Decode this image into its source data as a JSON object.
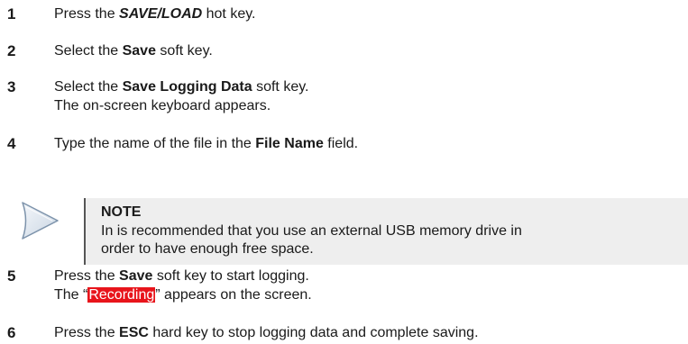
{
  "steps": [
    {
      "number": "1",
      "lines": [
        [
          "Press the ",
          "SAVE/LOAD",
          " hot key."
        ]
      ]
    },
    {
      "number": "2",
      "lines": [
        [
          "Select the ",
          "Save",
          " soft key."
        ]
      ]
    },
    {
      "number": "3",
      "lines": [
        [
          "Select the ",
          "Save Logging Data",
          " soft key."
        ],
        [
          "The on-screen keyboard appears."
        ]
      ]
    },
    {
      "number": "4",
      "lines": [
        [
          "Type the name of the file in the ",
          "File Name",
          " field."
        ]
      ]
    },
    {
      "number": "5",
      "lines": [
        [
          "Press the ",
          "Save",
          " soft key to start logging."
        ],
        [
          "The “",
          "Recording",
          "” appears on the screen."
        ]
      ]
    },
    {
      "number": "6",
      "lines": [
        [
          "Press the ",
          "ESC",
          " hard key to stop logging data and complete saving."
        ]
      ]
    }
  ],
  "note": {
    "title": "NOTE",
    "line1": "In is recommended that you use an external USB memory drive in",
    "line2": "order to have enough free space.",
    "icon": "note-arrow-icon"
  },
  "colors": {
    "recording_highlight": "#e8141b",
    "note_background": "#eeeeee"
  }
}
